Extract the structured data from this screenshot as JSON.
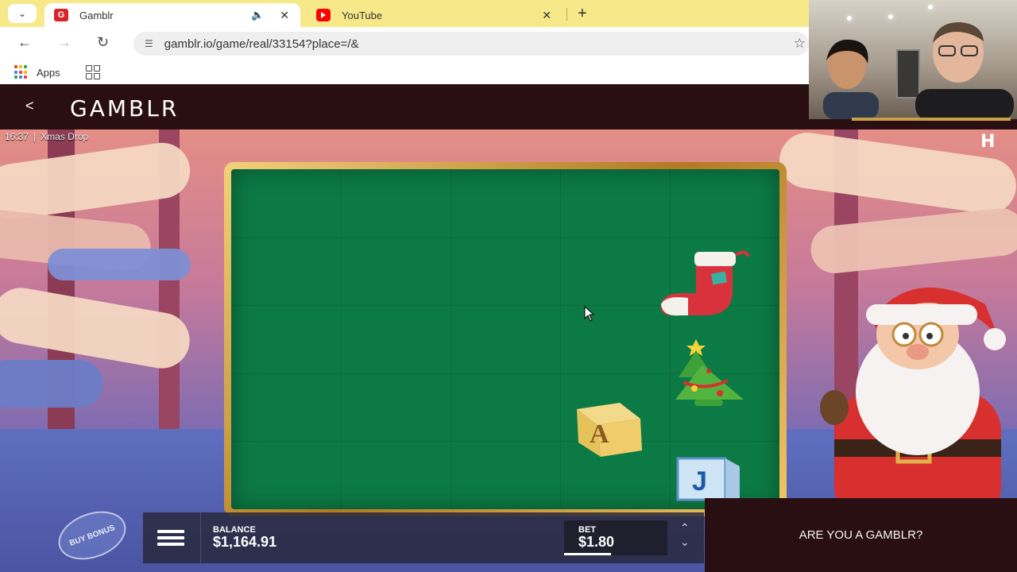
{
  "browser": {
    "tabs": [
      {
        "title": "Gamblr",
        "favicon": "gamblr-favicon",
        "active": true
      },
      {
        "title": "YouTube",
        "favicon": "youtube-favicon",
        "active": false
      }
    ],
    "url": "gamblr.io/game/real/33154?place=/&",
    "bookmarks": {
      "apps_label": "Apps"
    }
  },
  "site": {
    "logo_text": "GAMBLR",
    "back_glyph": "<"
  },
  "game": {
    "time": "16:37",
    "title": "Xmas Drop",
    "provider_logo": "H",
    "buy_bonus_label": "BUY BONUS",
    "balance_label": "BALANCE",
    "balance_value": "$1,164.91",
    "bet_label": "BET",
    "bet_value": "$1.80",
    "bet_progress": 0.45,
    "symbols": [
      "stocking-symbol",
      "christmas-tree-symbol",
      "letter-block-a-symbol",
      "letter-block-j-symbol"
    ],
    "block_a_letter": "A",
    "block_j_letter": "J"
  },
  "promo": {
    "text": "ARE YOU A GAMBLR?"
  },
  "colors": {
    "tabstrip": "#f7e98a",
    "site_header": "#2a0f12",
    "reel_green": "#0c7a45",
    "reel_gold": "#d4a84a"
  }
}
